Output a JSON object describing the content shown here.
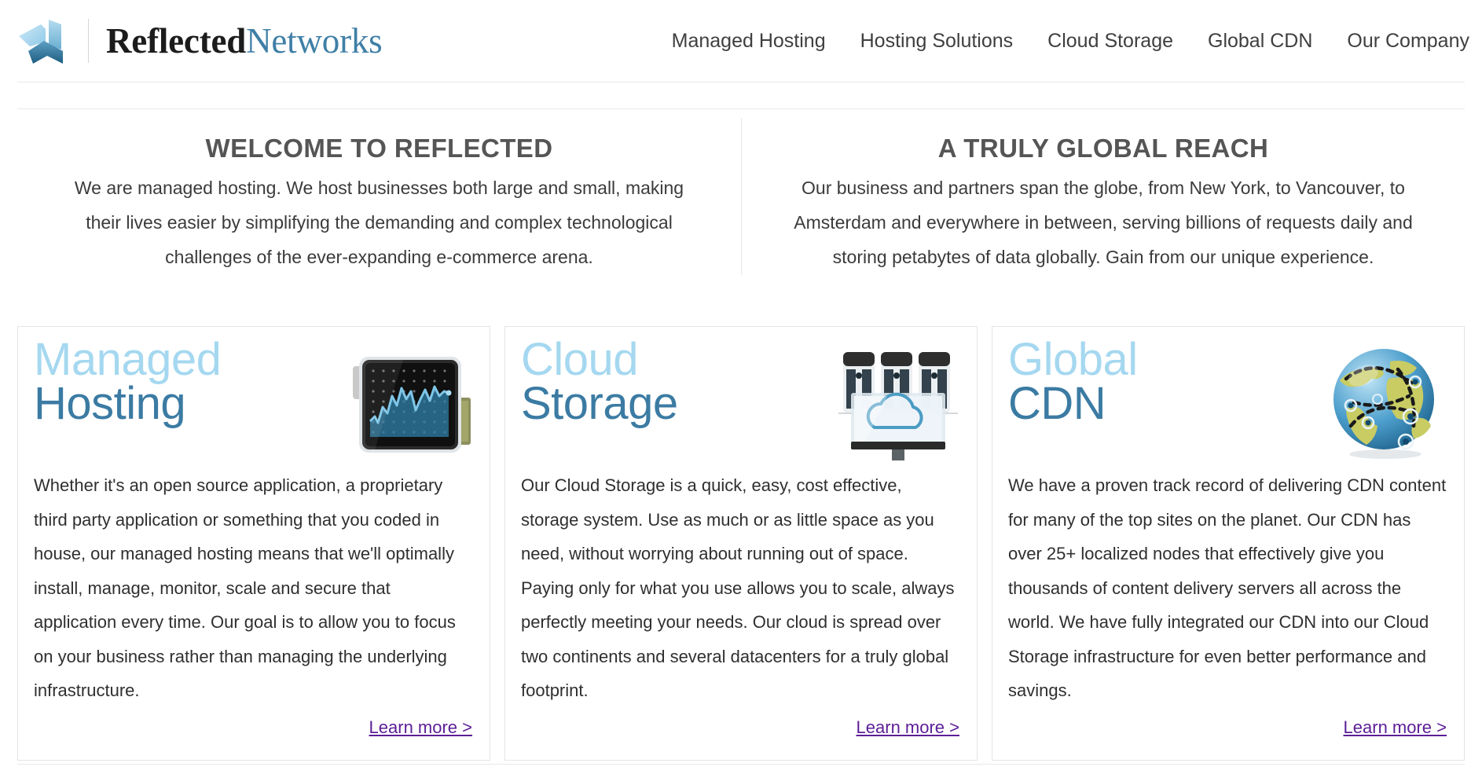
{
  "header": {
    "logo_icon": "reflected-networks-pinwheel-logo",
    "brand_bold": "Reflected",
    "brand_light": "Networks",
    "nav": [
      {
        "label": "Managed Hosting",
        "name": "nav-managed-hosting"
      },
      {
        "label": "Hosting Solutions",
        "name": "nav-hosting-solutions"
      },
      {
        "label": "Cloud Storage",
        "name": "nav-cloud-storage"
      },
      {
        "label": "Global CDN",
        "name": "nav-global-cdn"
      },
      {
        "label": "Our Company",
        "name": "nav-our-company"
      }
    ]
  },
  "welcome": {
    "left": {
      "title": "WELCOME TO REFLECTED",
      "body": "We are managed hosting. We host businesses both large and small, making their lives easier by simplifying the demanding and complex technological challenges of the ever-expanding e-commerce arena."
    },
    "right": {
      "title": "A TRULY GLOBAL REACH",
      "body": "Our business and partners span the globe, from New York, to Vancouver, to Amsterdam and everywhere in between, serving billions of requests daily and storing petabytes of data globally. Gain from our unique experience."
    }
  },
  "cards": [
    {
      "title_line1": "Managed",
      "title_line2": "Hosting",
      "icon": "tablet-area-chart-icon",
      "body": "Whether it's an open source application, a proprietary third party application or something that you coded in house, our managed hosting means that we'll optimally install, manage, monitor, scale and secure that application every time. Our goal is to allow you to focus on your business rather than managing the underlying infrastructure.",
      "link": "Learn more >"
    },
    {
      "title_line1": "Cloud",
      "title_line2": "Storage",
      "icon": "servers-cloud-monitor-icon",
      "body": "Our Cloud Storage is a quick, easy, cost effective, storage system. Use as much or as little space as you need, without worrying about running out of space. Paying only for what you use allows you to scale, always perfectly meeting your needs. Our cloud is spread over two continents and several datacenters for a truly global footprint.",
      "link": "Learn more >"
    },
    {
      "title_line1": "Global",
      "title_line2": "CDN",
      "icon": "globe-network-nodes-icon",
      "body": "We have a proven track record of delivering CDN content for many of the top sites on the planet. Our CDN has over 25+ localized nodes that effectively give you thousands of content delivery servers all across the world. We have fully integrated our CDN into our Cloud Storage infrastructure for even better performance and savings.",
      "link": "Learn more >"
    }
  ],
  "colors": {
    "brand_light_blue": "#a5d8f0",
    "brand_blue": "#3b7ba3",
    "wordmark_blue": "#3f7fa6",
    "link_purple": "#5c1e96",
    "heading_gray": "#555555",
    "nav_gray": "#3f3f3f",
    "rule_gray": "#e9e9e9"
  }
}
